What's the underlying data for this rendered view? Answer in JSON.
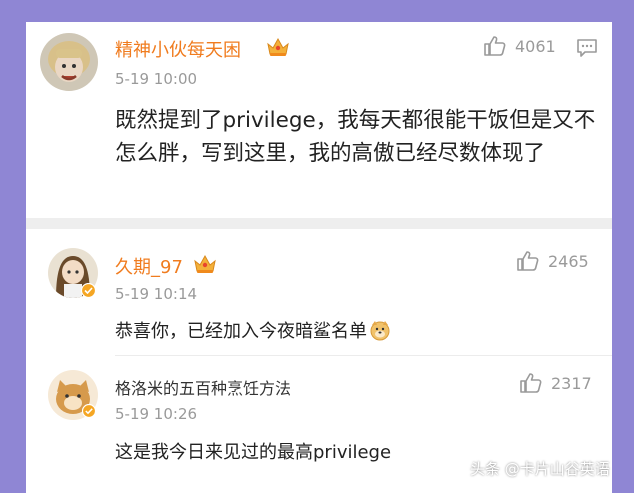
{
  "comments": [
    {
      "username": "精神小伙每天困",
      "time": "5-19 10:00",
      "likes": "4061",
      "text": "既然提到了privilege，我每天都很能干饭但是又不怎么胖，写到这里，我的高傲已经尽数体现了",
      "badge_icon": "crown-icon"
    },
    {
      "username": "久期_97",
      "time": "5-19 10:14",
      "likes": "2465",
      "text": "恭喜你，已经加入今夜暗鲨名单",
      "badge_icon": "crown-icon",
      "emoji_icon": "doge-emoji-icon"
    },
    {
      "username": "格洛米的五百种烹饪方法",
      "time": "5-19 10:26",
      "likes": "2317",
      "text": "这是我今日来见过的最高privilege"
    }
  ],
  "watermark": "头条 @卡片山谷英语",
  "colors": {
    "background": "#8f86d4",
    "username_accent": "#f07c1f",
    "muted": "#9a9a9a",
    "verified": "#f5a623"
  }
}
